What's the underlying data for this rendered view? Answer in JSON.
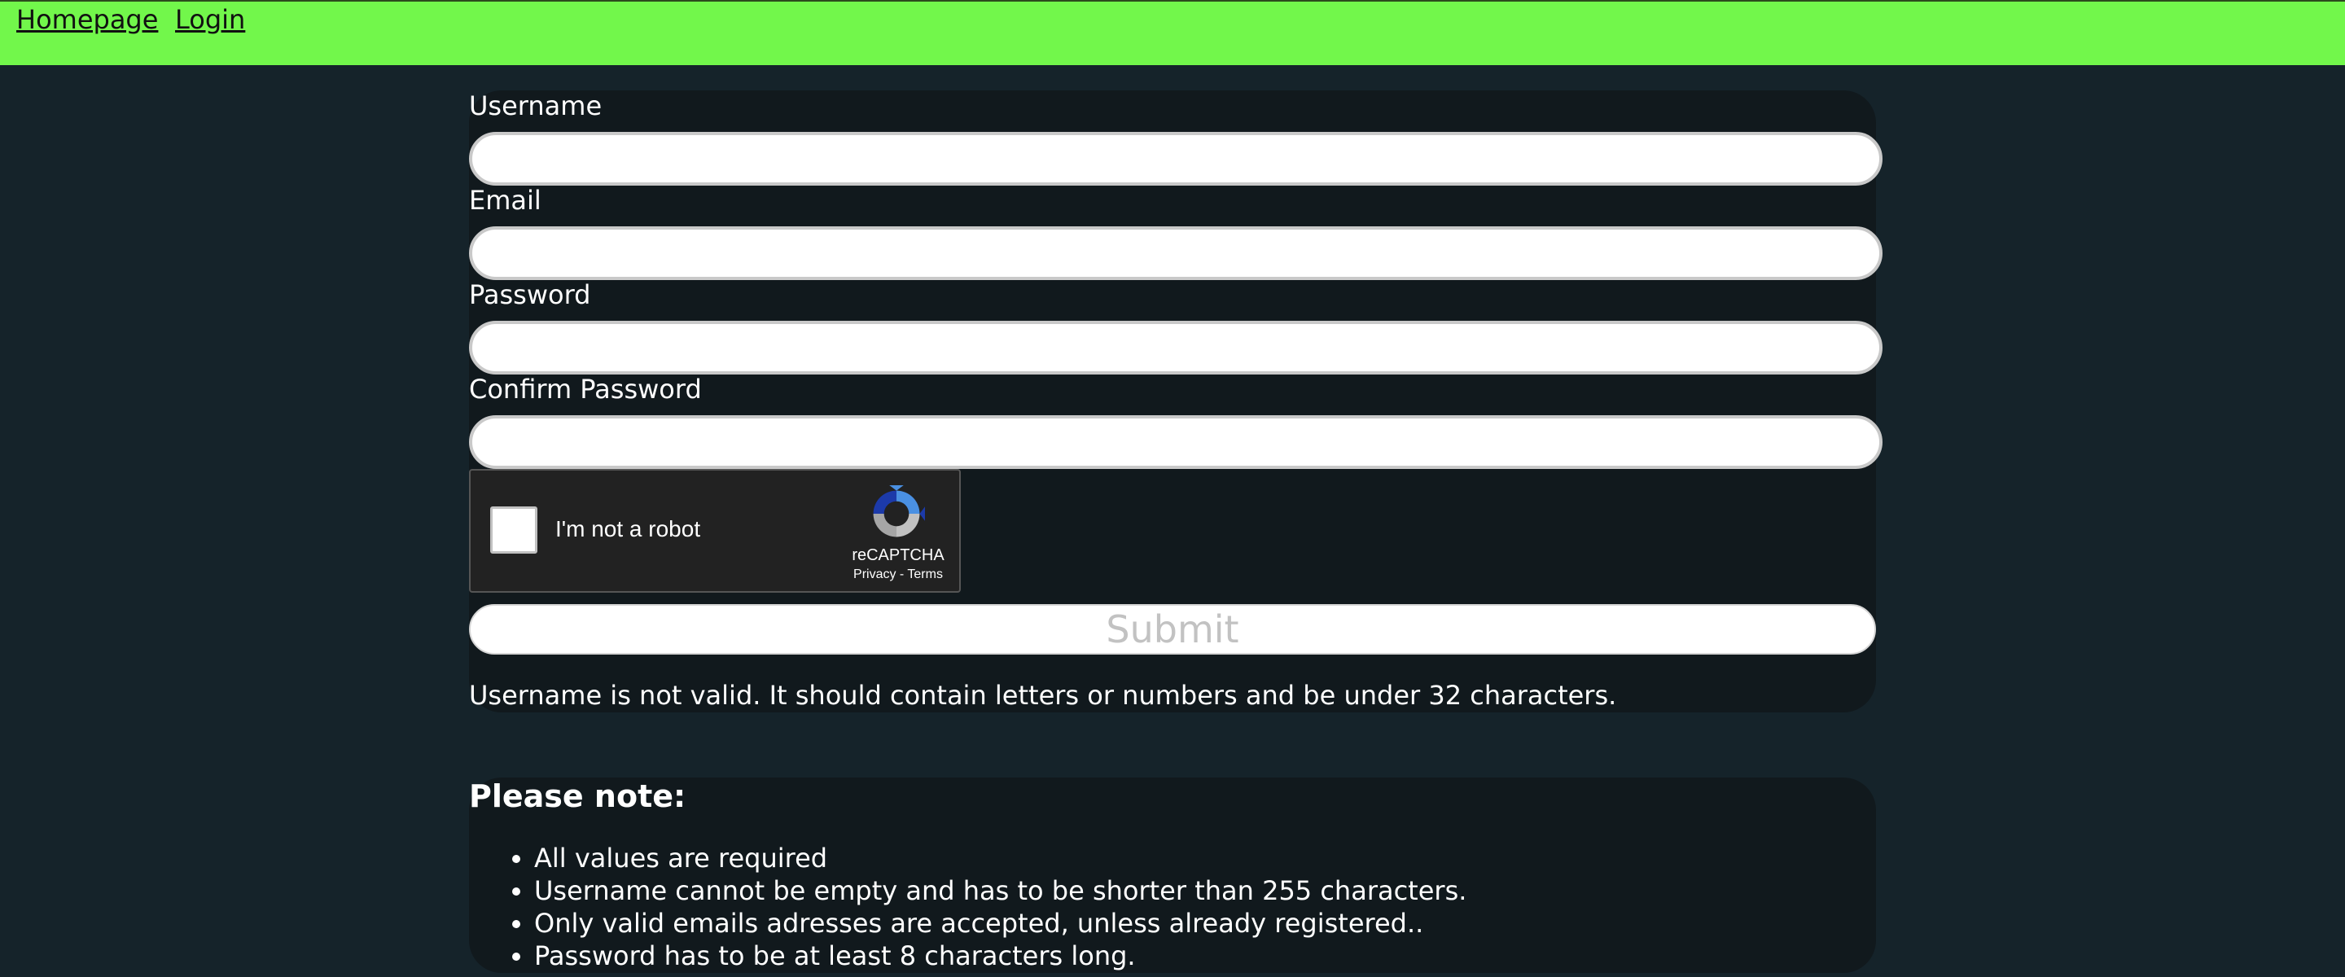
{
  "nav": {
    "homepage": "Homepage",
    "login": "Login"
  },
  "form": {
    "username_label": "Username",
    "email_label": "Email",
    "password_label": "Password",
    "confirm_password_label": "Confirm Password",
    "username_value": "",
    "email_value": "",
    "password_value": "",
    "confirm_password_value": ""
  },
  "recaptcha": {
    "label": "I'm not a robot",
    "brand": "reCAPTCHA",
    "privacy": "Privacy",
    "separator": " - ",
    "terms": "Terms",
    "checked": false
  },
  "submit_label": "Submit",
  "error_message": "Username is not valid. It should contain letters or numbers and be under 32 characters.",
  "notes": {
    "title": "Please note:",
    "items": [
      "All values are required",
      "Username cannot be empty and has to be shorter than 255 characters.",
      "Only valid emails adresses are accepted, unless already registered..",
      "Password has to be at least 8 characters long."
    ]
  },
  "colors": {
    "nav_background": "#72f74b",
    "page_background": "#15232a",
    "panel_background": "#11191d"
  }
}
